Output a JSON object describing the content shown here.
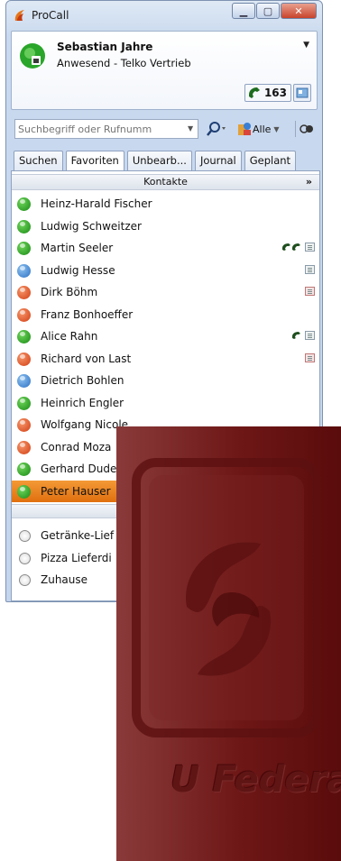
{
  "window": {
    "title": "ProCall",
    "controls": [
      "minimize",
      "maximize",
      "close"
    ]
  },
  "user": {
    "name": "Sebastian Jahre",
    "status": "Anwesend - Telko Vertrieb",
    "count": "163"
  },
  "search": {
    "placeholder": "Suchbegriff oder Rufnumm",
    "filter_label": "Alle"
  },
  "tabs": [
    {
      "label": "Suchen",
      "active": false
    },
    {
      "label": "Favoriten",
      "active": true
    },
    {
      "label": "Unbearb...",
      "active": false
    },
    {
      "label": "Journal",
      "active": false
    },
    {
      "label": "Geplant",
      "active": false
    }
  ],
  "contacts_group": {
    "title": "Kontakte"
  },
  "contacts": [
    {
      "name": "Heinz-Harald Fischer",
      "status": "green"
    },
    {
      "name": "Ludwig Schweitzer",
      "status": "green"
    },
    {
      "name": "Martin Seeler",
      "status": "green"
    },
    {
      "name": "Ludwig Hesse",
      "status": "blue"
    },
    {
      "name": "Dirk Böhm",
      "status": "red"
    },
    {
      "name": "Franz Bonhoeffer",
      "status": "red"
    },
    {
      "name": "Alice Rahn",
      "status": "green"
    },
    {
      "name": "Richard von Last",
      "status": "red"
    },
    {
      "name": "Dietrich Bohlen",
      "status": "blue"
    },
    {
      "name": "Heinrich Engler",
      "status": "green"
    },
    {
      "name": "Wolfgang Nicole",
      "status": "red"
    },
    {
      "name": "Conrad Moza",
      "status": "red"
    },
    {
      "name": "Gerhard Dude",
      "status": "green"
    },
    {
      "name": "Peter Hauser",
      "status": "green",
      "selected": true
    }
  ],
  "services": [
    {
      "name": "Getränke-Lief"
    },
    {
      "name": "Pizza Lieferdi"
    },
    {
      "name": "Zuhause"
    }
  ],
  "overlay": {
    "brand_text": "U Federation"
  },
  "colors": {
    "status_green": "#1f9a1a",
    "status_blue": "#2a6fc4",
    "status_red": "#d43d12",
    "selection": "#f0851f",
    "overlay_maroon": "#6e1717"
  }
}
